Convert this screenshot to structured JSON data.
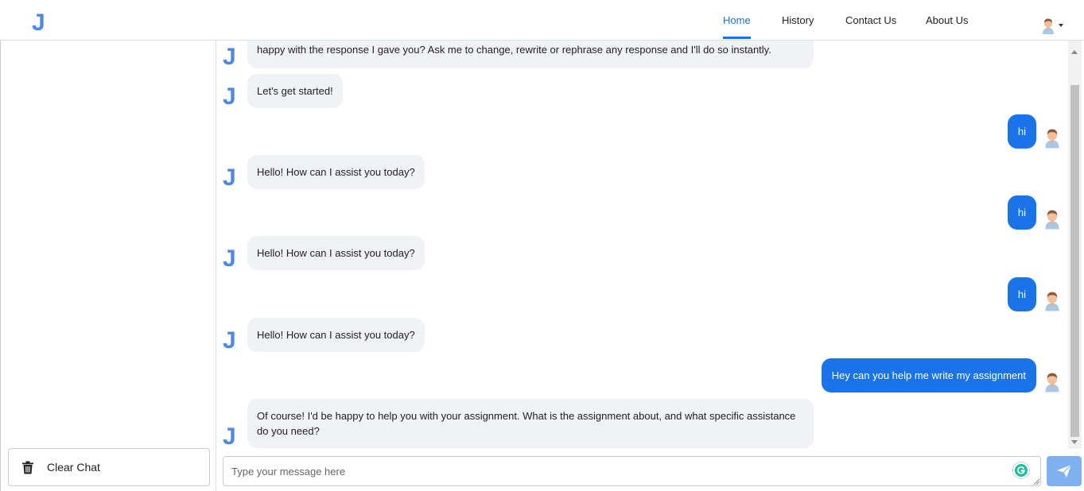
{
  "app": {
    "logo_letter": "J"
  },
  "nav": {
    "home": "Home",
    "history": "History",
    "contact": "Contact Us",
    "about": "About Us"
  },
  "sidebar": {
    "clear_chat_label": "Clear Chat"
  },
  "messages": [
    {
      "role": "bot",
      "text": "happy with the response I gave you? Ask me to change, rewrite or rephrase any response and I'll do so instantly."
    },
    {
      "role": "bot",
      "text": "Let's get started!"
    },
    {
      "role": "user",
      "text": "hi"
    },
    {
      "role": "bot",
      "text": "Hello! How can I assist you today?"
    },
    {
      "role": "user",
      "text": "hi"
    },
    {
      "role": "bot",
      "text": "Hello! How can I assist you today?"
    },
    {
      "role": "user",
      "text": "hi"
    },
    {
      "role": "bot",
      "text": "Hello! How can I assist you today?"
    },
    {
      "role": "user",
      "text": "Hey can you help me write my assignment"
    },
    {
      "role": "bot",
      "text": "Of course! I'd be happy to help you with your assignment. What is the assignment about, and what specific assistance do you need?"
    }
  ],
  "composer": {
    "placeholder": "Type your message here",
    "value": ""
  },
  "icons": {
    "logo": "j-logo-icon",
    "profile": "user-avatar-icon",
    "trash": "trash-icon",
    "send": "send-icon",
    "grammarly": "grammarly-icon"
  },
  "colors": {
    "accent": "#1a73e8",
    "logo": "#4e88e6",
    "bot_bubble": "#f1f2f5",
    "send_button": "#7fb0f0"
  }
}
